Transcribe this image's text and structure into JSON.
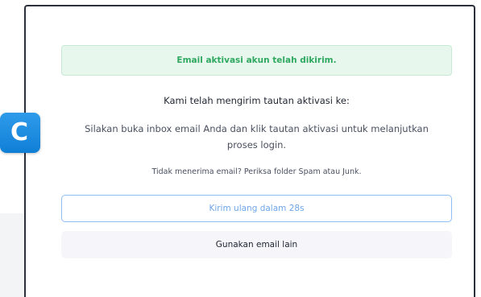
{
  "alert": {
    "message": "Email aktivasi akun telah dikirim."
  },
  "content": {
    "headline": "Kami telah mengirim tautan aktivasi ke:",
    "instructions": "Silakan buka inbox email Anda dan klik tautan aktivasi untuk melanjutkan proses login.",
    "hint": "Tidak menerima email? Periksa folder Spam atau Junk."
  },
  "actions": {
    "resend_label": "Kirim ulang dalam 28s",
    "other_email_label": "Gunakan email lain"
  },
  "logo": {
    "letter": "C",
    "color": "#1a8ce0"
  },
  "colors": {
    "success_bg": "#e8f7ee",
    "success_text": "#2fa860",
    "accent_border": "#8fbdf2",
    "accent_text": "#6fa6ea"
  }
}
